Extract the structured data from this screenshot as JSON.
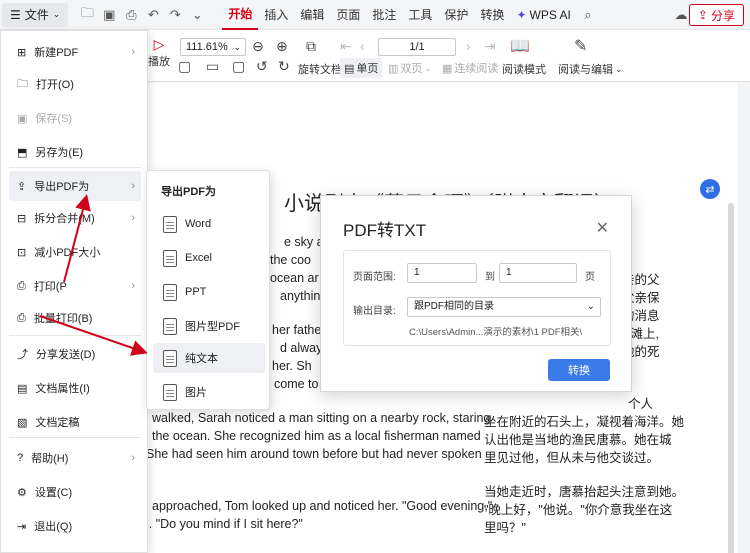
{
  "topbar": {
    "file_label": "文件",
    "tabs": [
      "开始",
      "插入",
      "编辑",
      "页面",
      "批注",
      "工具",
      "保护",
      "转换"
    ],
    "wps_ai": "WPS AI",
    "share_label": "分享"
  },
  "ribbon": {
    "zoom": "111.61%",
    "page": "1/1",
    "play_label": "播放",
    "rotate_label": "旋转文档",
    "single_label": "单页",
    "double_label": "双页",
    "continuous_label": "连续阅读",
    "reading_mode_label": "阅读模式",
    "read_edit_label": "阅读与编辑"
  },
  "file_menu": {
    "items": [
      {
        "label": "新建PDF",
        "has_sub": true
      },
      {
        "label": "打开(O)",
        "has_sub": false
      },
      {
        "label": "保存(S)",
        "has_sub": false
      },
      {
        "label": "另存为(E)",
        "has_sub": false
      },
      {
        "label": "导出PDF为",
        "has_sub": true
      },
      {
        "label": "拆分合并(M)",
        "has_sub": true
      },
      {
        "label": "减小PDF大小",
        "has_sub": false
      },
      {
        "label": "打印(P",
        "has_sub": true
      },
      {
        "label": "批量打印(B)",
        "has_sub": false
      },
      {
        "label": "分享发送(D)",
        "has_sub": true
      },
      {
        "label": "文档属性(I)",
        "has_sub": false
      },
      {
        "label": "文档定稿",
        "has_sub": false
      },
      {
        "label": "帮助(H)",
        "has_sub": true
      },
      {
        "label": "设置(C)",
        "has_sub": false
      },
      {
        "label": "退出(Q)",
        "has_sub": false
      }
    ]
  },
  "export_submenu": {
    "title": "导出PDF为",
    "items": [
      "Word",
      "Excel",
      "PPT",
      "图片型PDF",
      "纯文本",
      "图片"
    ]
  },
  "dialog": {
    "title": "PDF转TXT",
    "page_range_label": "页面范围:",
    "from_page": "1",
    "to_label": "到",
    "to_page": "1",
    "page_unit": "页",
    "output_label": "输出目录:",
    "output_option": "跟PDF相同的目录",
    "output_path": "C:\\Users\\Admin...演示的素材\\1 PDF相关\\",
    "convert_button": "转换"
  },
  "document": {
    "title": "小说剧本《落日余晖》（附中文翻译）",
    "en_lines": [
      "e sky a c",
      "the coo",
      "ocean ar",
      "anything",
      "her fathe",
      "d alway",
      "her. Sh",
      "come to",
      "walked, Sarah noticed a man sitting on a nearby rock, staring",
      "the ocean. She recognized him as a local fisherman named",
      "She had seen him around town before but had never spoken",
      "approached, Tom looked up and noticed her. \"Good evening,\"",
      "l. \"Do you mind if I sit here?\""
    ],
    "zh_lines": [
      "亲的父",
      "父亲保",
      "的消息",
      "海滩上,",
      "他的死",
      "个人",
      "坐在附近的石头上，凝视着海洋。她",
      "认出他是当地的渔民唐慕。她在城",
      "里见过他，但从未与他交谈过。",
      "当她走近时，唐慕抬起头注意到她。",
      "\"晚上好，\"他说。\"你介意我坐在这",
      "里吗？\""
    ]
  },
  "colors": {
    "accent": "#d0021b",
    "primary_button": "#3b7be8",
    "annotation_arrow": "#d0021b"
  }
}
